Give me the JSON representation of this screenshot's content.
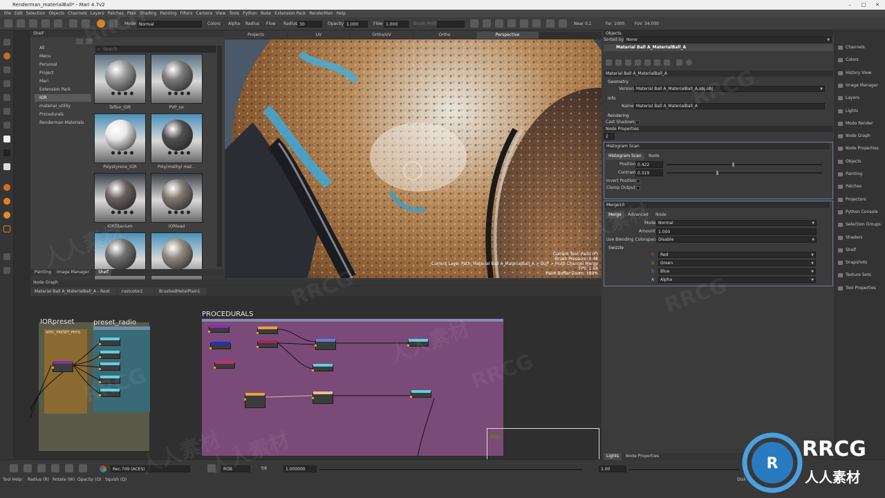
{
  "window": {
    "title": "Renderman_materialBall* - Mari 4.7v2"
  },
  "menu": [
    "File",
    "Edit",
    "Selection",
    "Objects",
    "Channels",
    "Layers",
    "Patches",
    "Ptex",
    "Shading",
    "Painting",
    "Filters",
    "Camera",
    "View",
    "Tools",
    "Python",
    "Nuke",
    "Extension Pack",
    "RenderMan",
    "Help"
  ],
  "toolbar": {
    "mode_label": "Mode",
    "mode_value": "Normal",
    "colors_label": "Colors",
    "alpha_label": "Alpha",
    "radius_toggle": "Radius",
    "flow_toggle": "Flow",
    "radius_label": "Radius",
    "radius_value": "30",
    "opacity_label": "Opacity",
    "opacity_value": "1.000",
    "flow_label": "Flow",
    "flow_value": "1.000",
    "brush_profile_label": "Brush Profile",
    "near_label": "Near",
    "near_value": "0.1",
    "far_label": "Far",
    "far_value": "1000",
    "fov_label": "FoV",
    "fov_value": "34.000"
  },
  "shelf": {
    "title": "Shelf",
    "search_placeholder": "Search",
    "nav": [
      "All",
      "Menu",
      "Personal",
      "Project",
      "Mari",
      "Extension Pack",
      "IOR",
      "material_utility",
      "Procedurals",
      "Renderman-Materials"
    ],
    "selected_nav": "IOR",
    "materials": [
      {
        "name": "Teflon_IOR",
        "tone": "#9a9a9a",
        "bg": "#5a7080"
      },
      {
        "name": "PVP_ior",
        "tone": "#7a7a7a",
        "bg": "#5a7080"
      },
      {
        "name": "Polystyrene_IOR",
        "tone": "#e8e8e8",
        "bg": "#4a90b8"
      },
      {
        "name": "Poly(methyl met...",
        "tone": "#505050",
        "bg": "#4a90b8"
      },
      {
        "name": "IORTitanium",
        "tone": "#6a6060",
        "bg": "#3a4048"
      },
      {
        "name": "IORlead",
        "tone": "#807870",
        "bg": "#3a4048"
      },
      {
        "name": "",
        "tone": "#707070",
        "bg": "#4a90b8"
      },
      {
        "name": "",
        "tone": "#908880",
        "bg": "#4a90b8"
      }
    ],
    "tabs": [
      "Painting",
      "Image Manager",
      "Shelf"
    ]
  },
  "viewport": {
    "tabs": [
      "Projects",
      "UV",
      "Ortho/UV",
      "Ortho",
      "Perspective"
    ],
    "active_tab": "Perspective",
    "info": [
      "Current Tool: Paint (P)",
      "Brush Pressure: 0.48",
      "Current Layer Path: Material Ball A_MaterialBall_A > BUP > Multi-Channel Merge",
      "FPS: 1.68",
      "Paint Buffer Zoom: 189%"
    ]
  },
  "node_graph": {
    "title": "Node Graph",
    "tabs": [
      "Material Ball A_MaterialBall_A - Root",
      "rustcolor2",
      "BrushedMetalPlain1"
    ],
    "backdrops": {
      "ior": "IORpreset",
      "spec": "SPEC_PRESET_PHYS",
      "radio": "preset_radio",
      "proc": "PROCEDURALS"
    }
  },
  "status": {
    "colorspace": "Rec.709 (ACES)",
    "channels": "RGB",
    "fstop": "f/8",
    "exposure": "1.000000",
    "zoom": "1.00",
    "help_label": "Tool Help:",
    "help_items": [
      "Radius (R)",
      "Rotate (W)",
      "Opacity (O)",
      "Squish (Q)"
    ],
    "disk_label": "Disk Ca"
  },
  "objects_panel": {
    "title": "Objects",
    "sorted_by_label": "Sorted by",
    "sorted_by_value": "None",
    "object_name": "Material Ball A_MaterialBall_A",
    "props_header": "Material Ball A_MaterialBall_A",
    "geometry": "Geometry",
    "version_label": "Version",
    "version_value": "Material Ball A_MaterialBall_A.obj.obj",
    "info": "Info",
    "name_label": "Name",
    "name_value": "Material Ball A_MaterialBall_A",
    "rendering": "Rendering",
    "cast_shadows": "Cast Shadows"
  },
  "node_properties": {
    "title": "Node Properties",
    "count": "2",
    "histogram": {
      "title": "Histogram Scan",
      "tab1": "Histogram Scan",
      "tab2": "Node",
      "position_label": "Position",
      "position_value": "0.422",
      "position_fraction": 0.42,
      "contrast_label": "Contrast",
      "contrast_value": "0.319",
      "contrast_fraction": 0.32,
      "invert_label": "Invert Position",
      "clamp_label": "Clamp Output"
    },
    "merge": {
      "title": "Merge10",
      "tab1": "Merge",
      "tab2": "Advanced",
      "tab3": "Node",
      "mode_label": "Mode",
      "mode_value": "Normal",
      "amount_label": "Amount",
      "amount_value": "1.000",
      "blend_label": "Use Blending Colorspace",
      "blend_value": "Disable",
      "swizzle": "Swizzle",
      "channels": [
        {
          "key": "R",
          "value": "Red",
          "color": "#e04040"
        },
        {
          "key": "G",
          "value": "Green",
          "color": "#40c040"
        },
        {
          "key": "B",
          "value": "Blue",
          "color": "#4080e0"
        },
        {
          "key": "A",
          "value": "Alpha",
          "color": "#c0c0c0"
        }
      ]
    }
  },
  "prop_tabs": [
    "Lights",
    "Node Properties"
  ],
  "right_menu": [
    "Channels",
    "Colors",
    "History View",
    "Image Manager",
    "Layers",
    "Lights",
    "Modo Render",
    "Node Graph",
    "Node Properties",
    "Objects",
    "Painting",
    "Patches",
    "Projectors",
    "Python Console",
    "Selection Groups",
    "Shaders",
    "Shelf",
    "Snapshots",
    "Texture Sets",
    "Tool Properties"
  ],
  "watermarks": {
    "rrcg": "RRCG",
    "cn": "人人素材"
  },
  "logo": {
    "big": "RRCG",
    "small": "人人素材"
  }
}
